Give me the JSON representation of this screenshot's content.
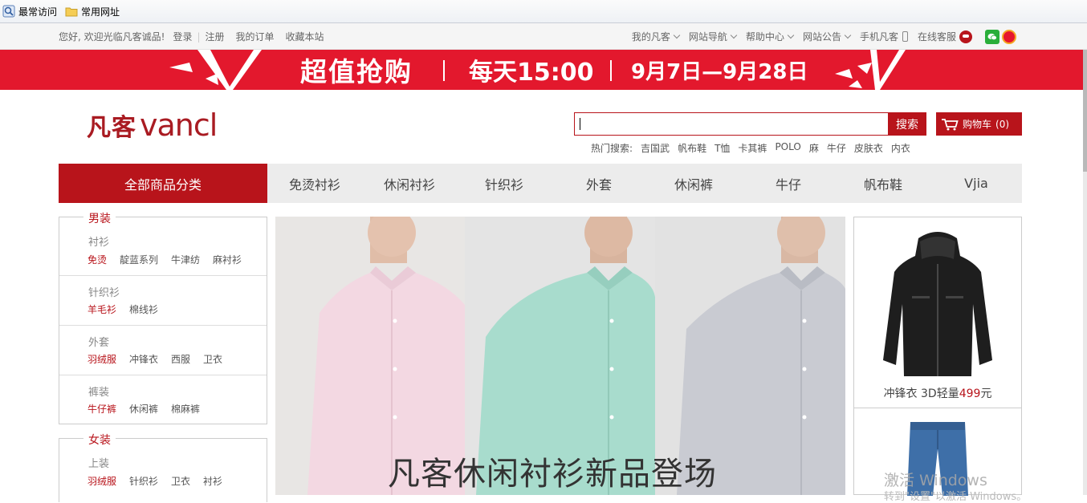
{
  "bookmarks": [
    {
      "label": "最常访问",
      "icon": "frequent-icon"
    },
    {
      "label": "常用网址",
      "icon": "folder-icon"
    }
  ],
  "topbar": {
    "welcome": "您好, 欢迎光临凡客诚品!",
    "login": "登录",
    "register": "注册",
    "my_orders": "我的订单",
    "bookmark_site": "收藏本站",
    "my_vancl": "我的凡客",
    "site_nav": "网站导航",
    "help": "帮助中心",
    "notice": "网站公告",
    "mobile": "手机凡客",
    "service": "在线客服"
  },
  "promo": {
    "headline": "超值抢购",
    "daily": "每天15:00",
    "dates": "9月7日—9月28日"
  },
  "header": {
    "logo_cn": "凡客",
    "logo_en": "vancl",
    "search_button": "搜索",
    "cart_label": "购物车",
    "cart_count": "(0)",
    "hot_label": "热门搜索:",
    "hot_keywords": [
      "吉国武",
      "帆布鞋",
      "T恤",
      "卡其裤",
      "POLO",
      "麻",
      "牛仔",
      "皮肤衣",
      "内衣"
    ]
  },
  "nav": {
    "all_categories": "全部商品分类",
    "items": [
      "免烫衬衫",
      "休闲衬衫",
      "针织衫",
      "外套",
      "休闲裤",
      "牛仔",
      "帆布鞋",
      "Vjia"
    ]
  },
  "categories": {
    "men": {
      "legend": "男装",
      "groups": [
        {
          "title": "衬衫",
          "links": [
            "免烫",
            "靛蓝系列",
            "牛津纺",
            "麻衬衫"
          ]
        },
        {
          "title": "针织衫",
          "links": [
            "羊毛衫",
            "棉线衫"
          ]
        },
        {
          "title": "外套",
          "links": [
            "羽绒服",
            "冲锋衣",
            "西服",
            "卫衣"
          ]
        },
        {
          "title": "裤装",
          "links": [
            "牛仔裤",
            "休闲裤",
            "棉麻裤"
          ]
        }
      ]
    },
    "women": {
      "legend": "女装",
      "groups": [
        {
          "title": "上装",
          "links": [
            "羽绒服",
            "针织衫",
            "卫衣",
            "衬衫"
          ]
        }
      ]
    }
  },
  "hero": {
    "caption": "凡客休闲衬衫新品登场",
    "shirt_colors": [
      "#f3d8e2",
      "#a8dccd",
      "#c9cbd2"
    ]
  },
  "side_products": [
    {
      "name": "冲锋衣 3D轻量",
      "price": "499",
      "unit": "元"
    }
  ],
  "watermark": {
    "line1": "激活 Windows",
    "line2": "转到\"设置\"以激活 Windows。"
  },
  "colors": {
    "brand_red": "#b8141b",
    "promo_red": "#e3182d"
  }
}
